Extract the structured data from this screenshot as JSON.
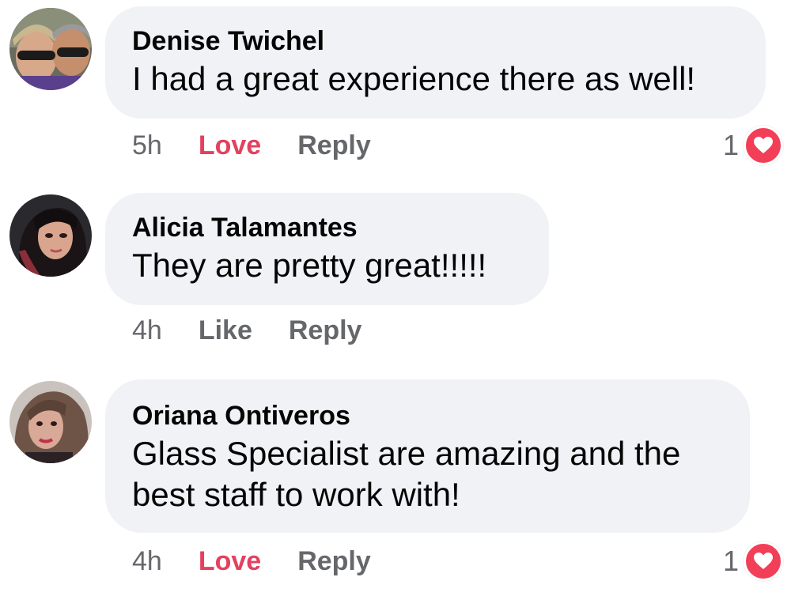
{
  "comments": [
    {
      "author": "Denise Twichel",
      "text": "I had a great experience there as well!",
      "time": "5h",
      "reaction_label": "Love",
      "reply_label": "Reply",
      "reaction_count": "1"
    },
    {
      "author": "Alicia Talamantes",
      "text": "They are pretty great!!!!!",
      "time": "4h",
      "reaction_label": "Like",
      "reply_label": "Reply"
    },
    {
      "author": "Oriana Ontiveros",
      "text": "Glass Specialist are amazing and the best staff to work with!",
      "time": "4h",
      "reaction_label": "Love",
      "reply_label": "Reply",
      "reaction_count": "1"
    }
  ],
  "colors": {
    "bubble": "#f0f2f5",
    "love": "#e4405f",
    "heart_badge": "#f33e58",
    "meta_text": "#65676b"
  },
  "icons": {
    "reaction_icon": "heart-icon"
  }
}
